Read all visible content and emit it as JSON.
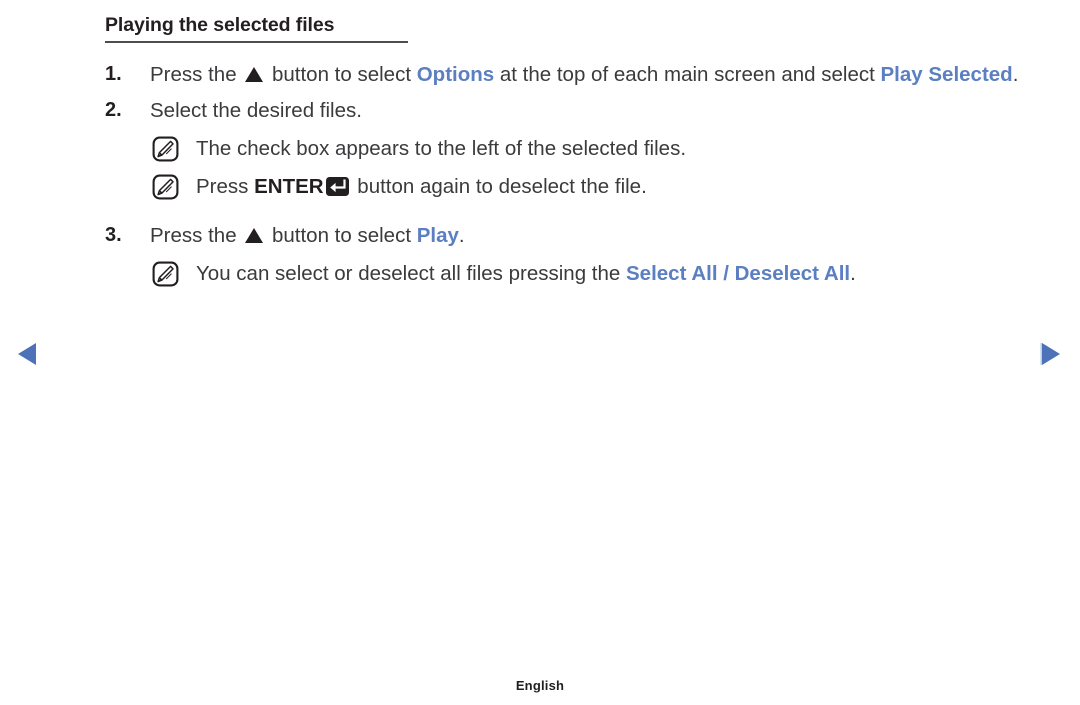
{
  "page": {
    "heading": "Playing the selected files",
    "language_footer": "English",
    "accent_blue": "#5b7fc1",
    "text_color": "#3b3b3d",
    "rule_color": "#4d4d4f",
    "background": "#ffffff"
  },
  "navigation": {
    "prev": {
      "icon": "triangle-left-icon",
      "label": "Previous page",
      "color": "#4d72b8"
    },
    "next": {
      "icon": "triangle-right-icon",
      "label": "Next page",
      "color": "#4d72b8"
    }
  },
  "steps": [
    {
      "number": "1.",
      "parts": [
        {
          "type": "text",
          "value": "Press the "
        },
        {
          "type": "icon",
          "value": "triangle-up-icon"
        },
        {
          "type": "text",
          "value": " button to select "
        },
        {
          "type": "highlight",
          "value": "Options"
        },
        {
          "type": "text",
          "value": " at the top of each main screen and select "
        },
        {
          "type": "highlight",
          "value": "Play Selected"
        },
        {
          "type": "text",
          "value": "."
        }
      ],
      "plain": "Press the ▲ button to select Options at the top of each main screen and select Play Selected.",
      "line1_prefix": "Press the ",
      "line1_mid": " button to select ",
      "line1_term": "Options",
      "line1_suffix": " at the top of each main screen and",
      "line2_prefix": "select ",
      "line2_term": "Play Selected",
      "line2_suffix": ".",
      "notes": []
    },
    {
      "number": "2.",
      "plain": "Select the desired files.",
      "notes": [
        {
          "icon": "note-pencil-icon",
          "plain": "The check box appears to the left of the selected files.",
          "prefix": "The check box appears to the left of the selected files.",
          "has_enter_key": false
        },
        {
          "icon": "note-pencil-icon",
          "plain": "Press ENTER↵ button again to deselect the file.",
          "prefix": "Press ",
          "keyword": "ENTER",
          "key_glyph": "enter-key-icon",
          "suffix": " button again to deselect the file.",
          "has_enter_key": true
        }
      ]
    },
    {
      "number": "3.",
      "plain": "Press the ▲ button to select Play.",
      "prefix": "Press the ",
      "mid": " button to select ",
      "term": "Play",
      "suffix": ".",
      "notes": [
        {
          "icon": "note-pencil-icon",
          "plain": "You can select or deselect all files pressing the Select All / Deselect All.",
          "prefix": "You can select or deselect all files pressing the ",
          "term": "Select All / Deselect All",
          "suffix": ".",
          "has_enter_key": false
        }
      ]
    }
  ]
}
